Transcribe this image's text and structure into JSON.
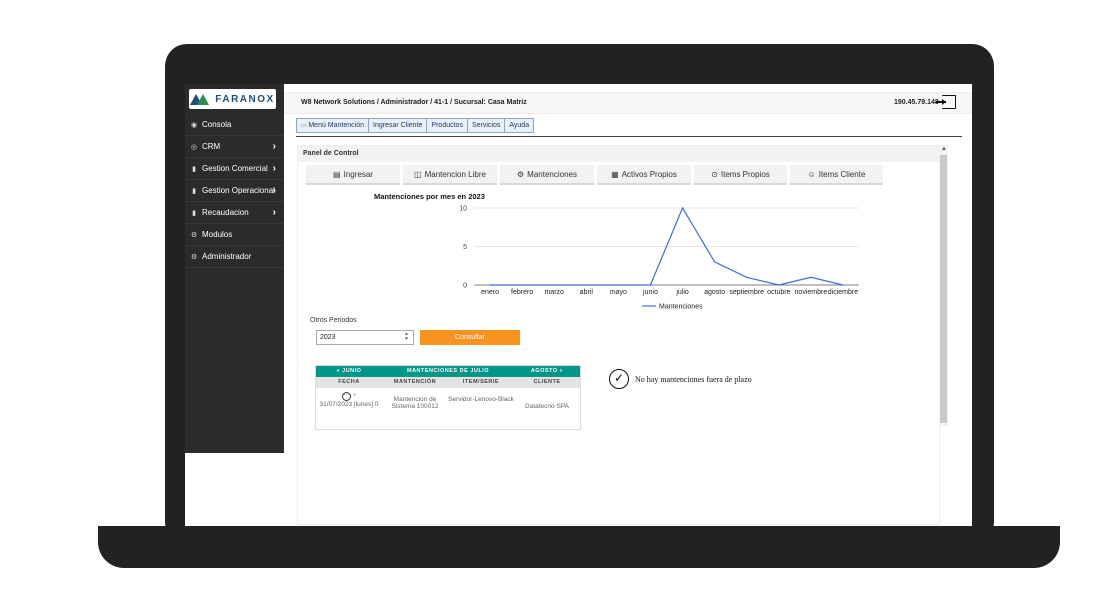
{
  "brand": {
    "logo_text": "FARANOX",
    "colors": {
      "sidebar": "#2b2b2b",
      "accent": "#009688",
      "button": "#f7931e",
      "line": "#3b6fd6"
    }
  },
  "sidebar": {
    "items": [
      {
        "label": "Consola",
        "icon": "dashboard-icon",
        "arrow": ""
      },
      {
        "label": "CRM",
        "icon": "eye-icon",
        "arrow": "›"
      },
      {
        "label": "Gestion Comercial",
        "icon": "book-icon",
        "arrow": "›"
      },
      {
        "label": "Gestion Operacional",
        "icon": "book-icon",
        "arrow": "›"
      },
      {
        "label": "Recaudacion",
        "icon": "book-icon",
        "arrow": "›"
      },
      {
        "label": "Modulos",
        "icon": "gears-icon",
        "arrow": ""
      },
      {
        "label": "Administrador",
        "icon": "gears-icon",
        "arrow": ""
      }
    ]
  },
  "header": {
    "breadcrumb": "W8 Network Solutions / Administrador / 41-1 / Sucursal: Casa Matriz",
    "ip": "190.45.79.148"
  },
  "menu": {
    "items": [
      "Menú Mantención",
      "Ingresar Cliente",
      "Productos",
      "Servicios",
      "Ayuda"
    ]
  },
  "panel": {
    "title": "Panel de Control"
  },
  "quick_buttons": [
    {
      "label": "Ingresar",
      "icon": "calendar-edit-icon"
    },
    {
      "label": "Mantencion Libre",
      "icon": "window-icon"
    },
    {
      "label": "Mantenciones",
      "icon": "gear-icon"
    },
    {
      "label": "Activos Propios",
      "icon": "calendar-icon"
    },
    {
      "label": "Items Propios",
      "icon": "circle-dots-icon"
    },
    {
      "label": "Items Cliente",
      "icon": "users-icon"
    }
  ],
  "chart_data": {
    "type": "line",
    "title": "Mantenciones por mes en 2023",
    "categories": [
      "enero",
      "febrero",
      "marzo",
      "abril",
      "mayo",
      "junio",
      "julio",
      "agosto",
      "septiembre",
      "octubre",
      "noviembre",
      "diciembre"
    ],
    "series": [
      {
        "name": "Mantenciones",
        "values": [
          0,
          0,
          0,
          0,
          0,
          0,
          10,
          3,
          1,
          0,
          1,
          0
        ]
      }
    ],
    "yticks": [
      "0",
      "5",
      "10"
    ],
    "ylim": [
      0,
      10
    ],
    "grid": true,
    "legend": "bottom"
  },
  "periodos": {
    "label": "Otros Periodos",
    "year": "2023",
    "button": "Consultar"
  },
  "maint_table": {
    "nav": {
      "prev": "« JUNIO",
      "title": "MANTENCIONES DE JULIO",
      "next": "AGOSTO »"
    },
    "columns": [
      "FECHA",
      "MANTENCIÓN",
      "ITEM/SERIE",
      "CLIENTE"
    ],
    "rows": [
      {
        "fecha": "31/07/2023 [lunes] 0",
        "mantencion": "Mantencion de Sistema 100012",
        "item": "Servidor-Lenovo-Black",
        "cliente": "Datatecno SPA"
      }
    ]
  },
  "status": {
    "no_plazo": "No hay mantenciones fuera de plazo"
  }
}
